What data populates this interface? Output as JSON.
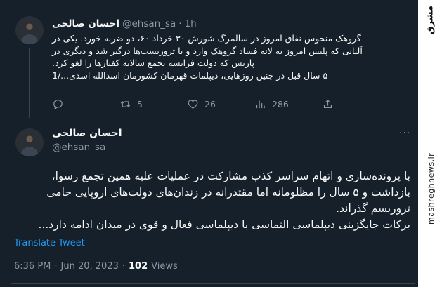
{
  "watermark": {
    "logo_text": "مشرق",
    "site_text": "mashreghnews.ir"
  },
  "top_tweet": {
    "name": "احسان صالحی",
    "handle": "@ehsan_sa",
    "separator": "·",
    "time": "1h",
    "text_lines": [
      "گروهک منحوس نفاق امروز در سالمرگ شورش ۳۰ خرداد ۶۰، دو ضربه خورد. یکی در",
      "آلبانی که پلیس امروز به لانه فساد گروهک وارد و با تروریست‌ها درگیر شد و دیگری در",
      "پاریس که دولت فرانسه تجمع سالانه کفتارها را لغو کرد.",
      "۵ سال قبل در چنین روزهایی، دیپلمات قهرمان کشورمان اسدالله اسدی.../1"
    ],
    "actions": {
      "reply_count": "",
      "retweet_count": "5",
      "like_count": "26",
      "views_count": "286"
    }
  },
  "main_tweet": {
    "name": "احسان صالحی",
    "handle": "@ehsan_sa",
    "text_lines": [
      "با پرونده‌سازی و اتهام سراسر کذب مشارکت در عملیات علیه همین تجمع رسوا،",
      "بازداشت و ۵ سال را مظلومانه اما مقتدرانه در زندان‌های دولت‌های اروپایی حامی",
      "تروریسم گذراند.",
      "برکات جایگزینی دیپلماسی التماسی با دیپلماسی فعال و قوی در میدان ادامه دارد..."
    ],
    "translate_label": "Translate Tweet",
    "time": "6:36 PM",
    "separator": "·",
    "date": "Jun 20, 2023",
    "views_count": "102",
    "views_label": "Views"
  }
}
